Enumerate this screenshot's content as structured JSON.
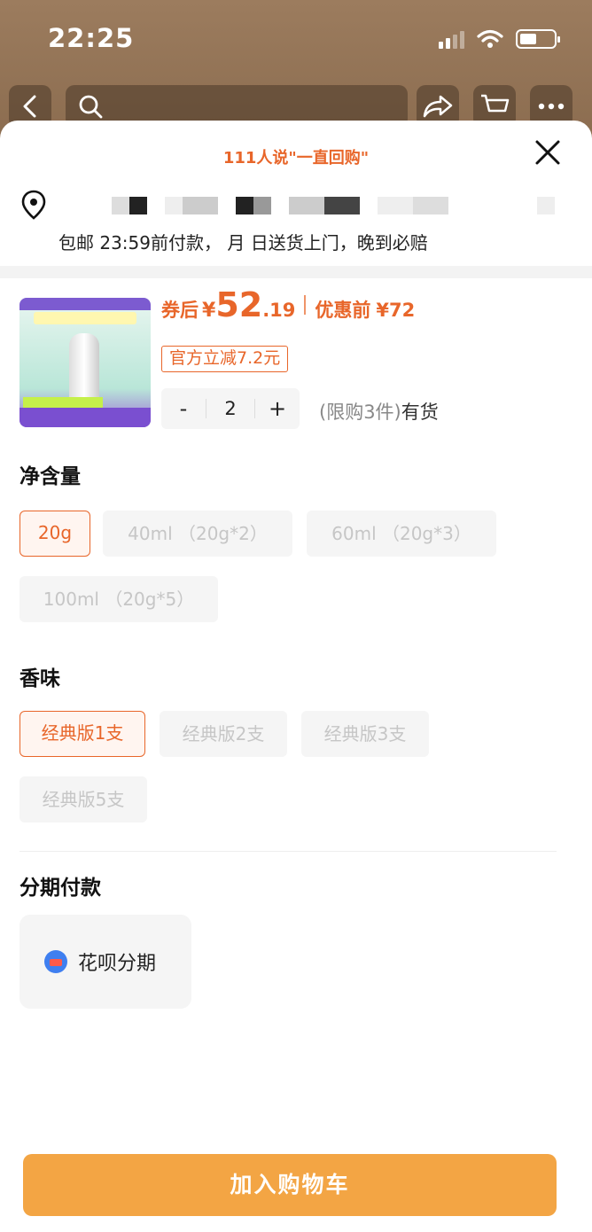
{
  "status_bar": {
    "time": "22:25"
  },
  "top_nav": {
    "icons": [
      "back-icon",
      "search-icon",
      "share-icon",
      "cart-icon",
      "more-icon"
    ]
  },
  "sheet": {
    "repurchase_text": "111人说\"一直回购\"",
    "address": {
      "line2": "包邮 23:59前付款，  月  日送货上门，晚到必赔",
      "icon": "location-pin-icon"
    },
    "product": {
      "price_label": "券后",
      "currency": "¥",
      "price_integer": "52",
      "price_decimal": ".19",
      "before_label": "优惠前",
      "before_price": "¥72",
      "coupon_tag": "官方立减7.2元",
      "quantity": "2",
      "minus": "-",
      "plus": "+",
      "limit_text": "(限购3件)",
      "stock_text": "有货"
    },
    "spec_sections": [
      {
        "title": "净含量",
        "options": [
          {
            "label": "20g",
            "selected": true
          },
          {
            "label": "40ml （20g*2）",
            "selected": false
          },
          {
            "label": "60ml （20g*3）",
            "selected": false
          },
          {
            "label": "100ml （20g*5）",
            "selected": false
          }
        ]
      },
      {
        "title": "香味",
        "options": [
          {
            "label": "经典版1支",
            "selected": true
          },
          {
            "label": "经典版2支",
            "selected": false
          },
          {
            "label": "经典版3支",
            "selected": false
          },
          {
            "label": "经典版5支",
            "selected": false
          }
        ]
      }
    ],
    "installment": {
      "title": "分期付款",
      "option_label": "花呗分期"
    },
    "add_to_cart": "加入购物车"
  },
  "colors": {
    "accent": "#e8662a",
    "cart_button": "#f3a544"
  }
}
